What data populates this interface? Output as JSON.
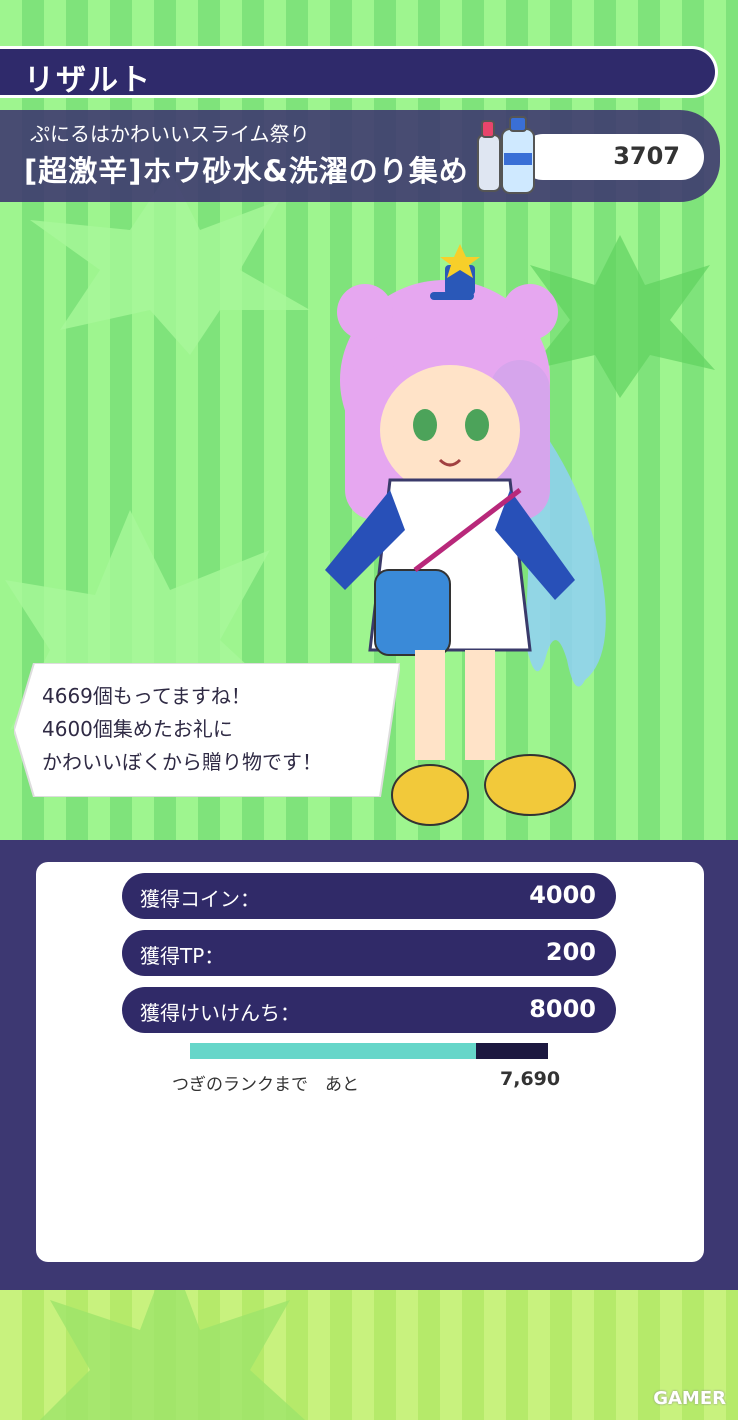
{
  "header": {
    "title": "リザルト"
  },
  "event": {
    "subtitle": "ぷにるはかわいいスライム祭り",
    "name": "[超激辛]ホウ砂水&洗濯のり集め",
    "item_count": "3707"
  },
  "dialogue": {
    "line1": "4669個もってますね！",
    "line2": "4600個集めたお礼に",
    "line3": "かわいいぼくから贈り物です！"
  },
  "rewards": [
    {
      "label": "獲得コイン：",
      "value": "4000"
    },
    {
      "label": "獲得TP：",
      "value": "200"
    },
    {
      "label": "獲得けいけんち：",
      "value": "8000"
    }
  ],
  "rank": {
    "next_label": "つぎのランクまで　あと",
    "remaining": "7,690",
    "progress": 0.8
  },
  "watermark": "GAMER",
  "colors": {
    "panel": "#302a68",
    "accent": "#66d6c9"
  }
}
